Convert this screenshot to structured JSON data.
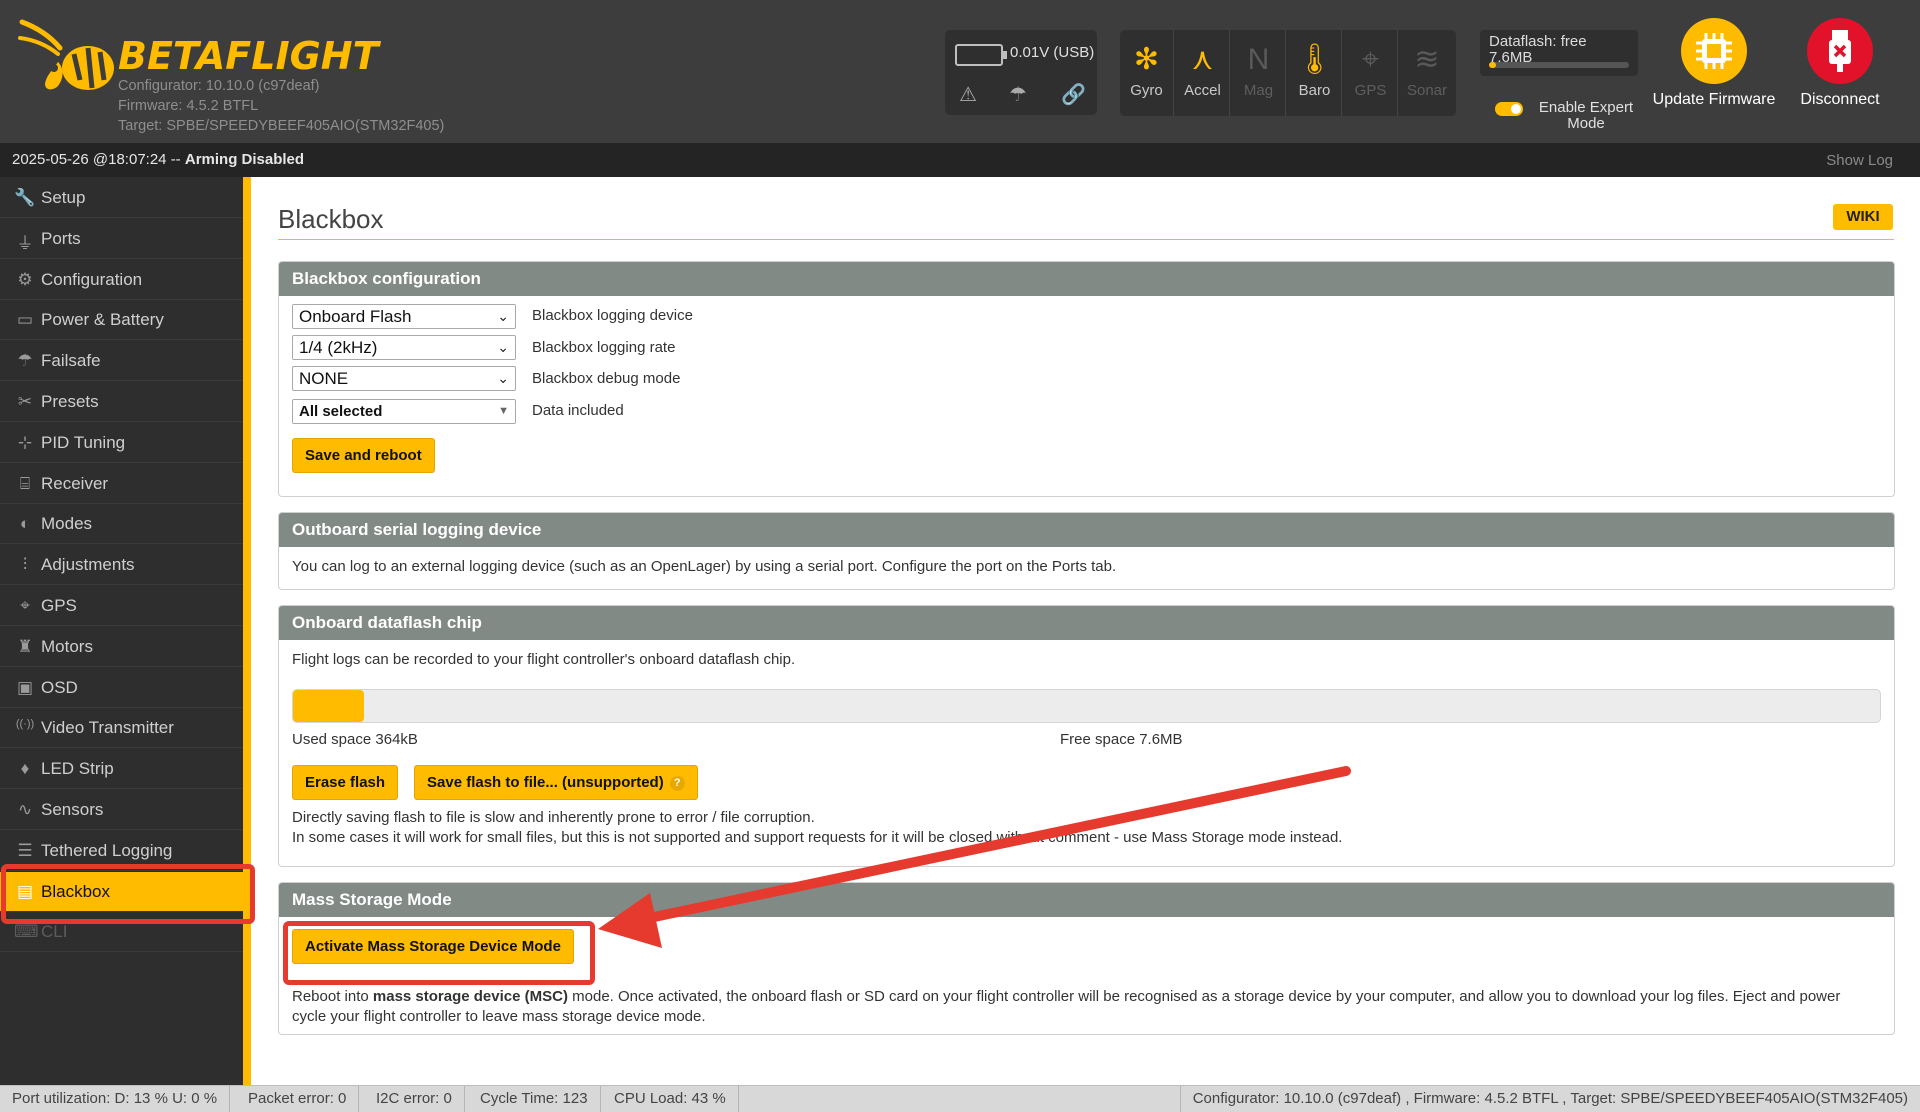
{
  "app": {
    "name": "BETAFLIGHT",
    "configurator": "Configurator: 10.10.0 (c97deaf)",
    "firmware": "Firmware: 4.5.2 BTFL",
    "target": "Target: SPBE/SPEEDYBEEF405AIO(STM32F405)"
  },
  "battery": {
    "voltage": "0.01V (USB)"
  },
  "sensors": [
    {
      "label": "Gyro",
      "active": true
    },
    {
      "label": "Accel",
      "active": true
    },
    {
      "label": "Mag",
      "active": false
    },
    {
      "label": "Baro",
      "active": true
    },
    {
      "label": "GPS",
      "active": false
    },
    {
      "label": "Sonar",
      "active": false
    }
  ],
  "dataflash": {
    "label": "Dataflash: free",
    "value": "7.6MB",
    "used_fraction": 0.05
  },
  "expert_mode": {
    "label": "Enable Expert Mode",
    "enabled": true
  },
  "header_buttons": {
    "update": "Update Firmware",
    "disconnect": "Disconnect"
  },
  "statusbar": {
    "datetime": "2025-05-26 @18:07:24",
    "separator": "--",
    "arming": "Arming Disabled",
    "show_log": "Show Log"
  },
  "sidebar": {
    "items": [
      {
        "label": "Setup",
        "icon": "wrench-icon"
      },
      {
        "label": "Ports",
        "icon": "plug-icon"
      },
      {
        "label": "Configuration",
        "icon": "gear-icon"
      },
      {
        "label": "Power & Battery",
        "icon": "battery-icon"
      },
      {
        "label": "Failsafe",
        "icon": "parachute-icon"
      },
      {
        "label": "Presets",
        "icon": "tools-icon"
      },
      {
        "label": "PID Tuning",
        "icon": "pid-icon"
      },
      {
        "label": "Receiver",
        "icon": "receiver-icon"
      },
      {
        "label": "Modes",
        "icon": "toggle-icon"
      },
      {
        "label": "Adjustments",
        "icon": "sliders-icon"
      },
      {
        "label": "GPS",
        "icon": "satellite-icon"
      },
      {
        "label": "Motors",
        "icon": "motor-icon"
      },
      {
        "label": "OSD",
        "icon": "osd-icon"
      },
      {
        "label": "Video Transmitter",
        "icon": "broadcast-icon"
      },
      {
        "label": "LED Strip",
        "icon": "led-icon"
      },
      {
        "label": "Sensors",
        "icon": "pulse-icon"
      },
      {
        "label": "Tethered Logging",
        "icon": "log-icon"
      },
      {
        "label": "Blackbox",
        "icon": "blackbox-icon",
        "active": true
      },
      {
        "label": "CLI",
        "icon": "terminal-icon"
      }
    ]
  },
  "page": {
    "title": "Blackbox",
    "wiki": "WIKI"
  },
  "config_panel": {
    "title": "Blackbox configuration",
    "rows": [
      {
        "value": "Onboard Flash",
        "label": "Blackbox logging device"
      },
      {
        "value": "1/4 (2kHz)",
        "label": "Blackbox logging rate"
      },
      {
        "value": "NONE",
        "label": "Blackbox debug mode"
      },
      {
        "value": "All selected",
        "label": "Data included"
      }
    ],
    "save_button": "Save and reboot"
  },
  "outboard_panel": {
    "title": "Outboard serial logging device",
    "text": "You can log to an external logging device (such as an OpenLager) by using a serial port. Configure the port on the Ports tab."
  },
  "dataflash_panel": {
    "title": "Onboard dataflash chip",
    "text": "Flight logs can be recorded to your flight controller's onboard dataflash chip.",
    "used_label": "Used space 364kB",
    "free_label": "Free space 7.6MB",
    "used_fraction": 0.045,
    "erase_button": "Erase flash",
    "save_button": "Save flash to file... (unsupported)",
    "note_line1": "Directly saving flash to file is slow and inherently prone to error / file corruption.",
    "note_line2": "In some cases it will work for small files, but this is not supported and support requests for it will be closed without comment - use Mass Storage mode instead."
  },
  "msc_panel": {
    "title": "Mass Storage Mode",
    "button": "Activate Mass Storage Device Mode",
    "text_before": "Reboot into ",
    "text_bold": "mass storage device (MSC)",
    "text_after": " mode. Once activated, the onboard flash or SD card on your flight controller will be recognised as a storage device by your computer, and allow you to download your log files. Eject and power cycle your flight controller to leave mass storage device mode."
  },
  "footer": {
    "port_util": "Port utilization: D: 13 % U: 0 %",
    "packet_error": "Packet error: 0",
    "i2c_error": "I2C error: 0",
    "cycle_time": "Cycle Time: 123",
    "cpu_load": "CPU Load: 43 %",
    "version": "Configurator: 10.10.0 (c97deaf) , Firmware: 4.5.2 BTFL , Target: SPBE/SPEEDYBEEF405AIO(STM32F405)"
  },
  "colors": {
    "accent": "#ffbb00",
    "annotation": "#e53a2d",
    "header": "#3d3d3d",
    "panel_head": "#828a86"
  }
}
